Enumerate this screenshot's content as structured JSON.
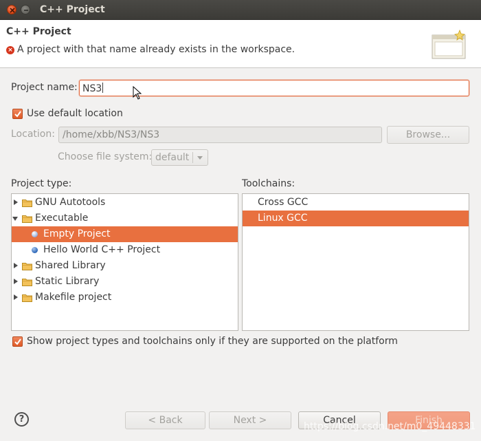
{
  "window": {
    "title": "C++ Project"
  },
  "banner": {
    "title": "C++ Project",
    "error_message": "A project with that name already exists in the workspace.",
    "error_icon": "error-icon"
  },
  "project_name": {
    "label": "Project name:",
    "value": "NS3"
  },
  "location": {
    "use_default_label": "Use default location",
    "use_default_checked": true,
    "label": "Location:",
    "value": "/home/xbb/NS3/NS3",
    "browse_label": "Browse...",
    "file_system_label": "Choose file system:",
    "file_system_value": "default"
  },
  "project_type": {
    "label": "Project type:",
    "items": [
      {
        "label": "GNU Autotools",
        "icon": "folder-icon",
        "expander": "collapsed"
      },
      {
        "label": "Executable",
        "icon": "folder-icon",
        "expander": "expanded"
      },
      {
        "label": "Empty Project",
        "icon": "template-icon",
        "selected": true
      },
      {
        "label": "Hello World C++ Project",
        "icon": "template-icon"
      },
      {
        "label": "Shared Library",
        "icon": "folder-icon",
        "expander": "collapsed"
      },
      {
        "label": "Static Library",
        "icon": "folder-icon",
        "expander": "collapsed"
      },
      {
        "label": "Makefile project",
        "icon": "folder-icon",
        "expander": "collapsed"
      }
    ]
  },
  "toolchains": {
    "label": "Toolchains:",
    "items": [
      {
        "label": "Cross GCC"
      },
      {
        "label": "Linux GCC",
        "selected": true
      }
    ]
  },
  "filter": {
    "label": "Show project types and toolchains only if they are supported on the platform",
    "checked": true
  },
  "buttons": {
    "back": "< Back",
    "next": "Next >",
    "cancel": "Cancel",
    "finish": "Finish"
  },
  "watermark": "https://blog.csdn.net/m0_49448331",
  "colors": {
    "accent": "#e8703f",
    "error": "#d6361d",
    "titlebar": "#3c3b37"
  }
}
